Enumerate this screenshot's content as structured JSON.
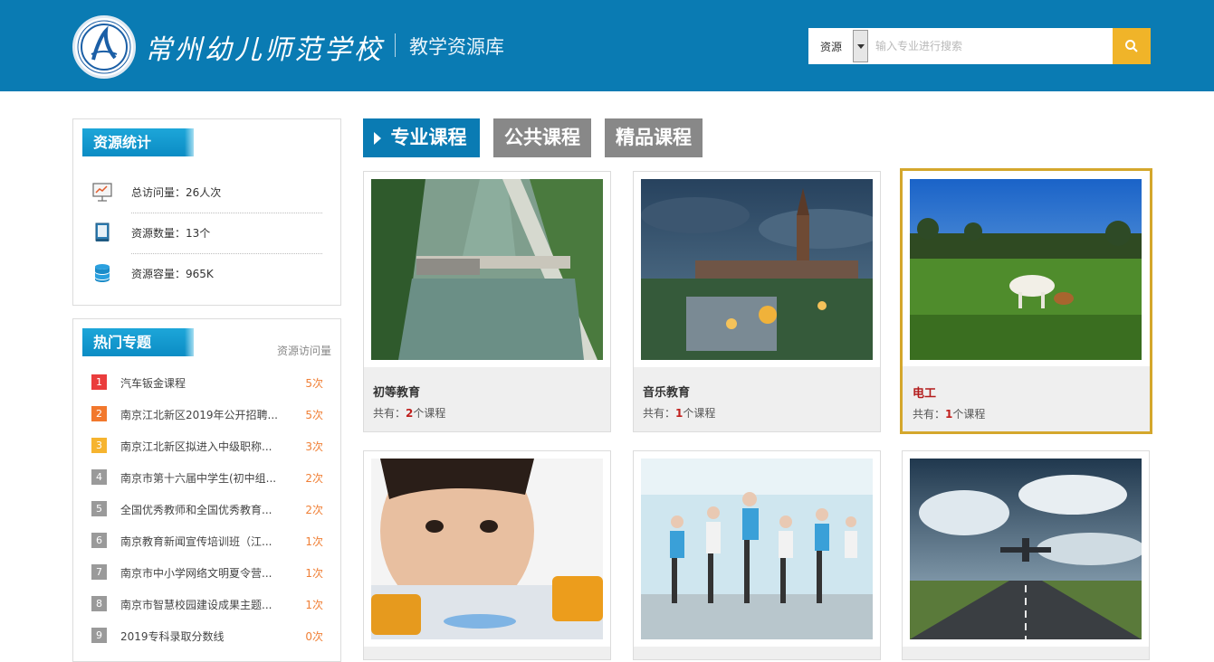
{
  "header": {
    "school_name": "常州幼儿师范学校",
    "subtitle": "教学资源库",
    "search": {
      "select_value": "资源",
      "placeholder": "输入专业进行搜索"
    },
    "icons": {
      "logo": "school-logo-icon",
      "search": "search-icon"
    }
  },
  "stats": {
    "title": "资源统计",
    "items": [
      {
        "icon": "chart-board-icon",
        "label": "总访问量：26人次"
      },
      {
        "icon": "book-icon",
        "label": "资源数量：13个"
      },
      {
        "icon": "database-icon",
        "label": "资源容量：965K"
      }
    ]
  },
  "hot": {
    "title": "热门专题",
    "column_label": "资源访问量",
    "items": [
      {
        "rank": "1",
        "title": "汽车钣金课程",
        "count": "5次"
      },
      {
        "rank": "2",
        "title": "南京江北新区2019年公开招聘...",
        "count": "5次"
      },
      {
        "rank": "3",
        "title": "南京江北新区拟进入中级职称...",
        "count": "3次"
      },
      {
        "rank": "4",
        "title": "南京市第十六届中学生(初中组...",
        "count": "2次"
      },
      {
        "rank": "5",
        "title": "全国优秀教师和全国优秀教育...",
        "count": "2次"
      },
      {
        "rank": "6",
        "title": "南京教育新闻宣传培训班（江...",
        "count": "1次"
      },
      {
        "rank": "7",
        "title": "南京市中小学网络文明夏令营...",
        "count": "1次"
      },
      {
        "rank": "8",
        "title": "南京市智慧校园建设成果主题...",
        "count": "1次"
      },
      {
        "rank": "9",
        "title": "2019专科录取分数线",
        "count": "0次"
      }
    ]
  },
  "tabs": [
    {
      "label": "专业课程",
      "active": true
    },
    {
      "label": "公共课程",
      "active": false
    },
    {
      "label": "精品课程",
      "active": false
    }
  ],
  "cards": [
    {
      "name": "初等教育",
      "count_prefix": "共有：",
      "count": "2",
      "count_suffix": "个课程",
      "image": "dam-river-aerial"
    },
    {
      "name": "音乐教育",
      "count_prefix": "共有：",
      "count": "1",
      "count_suffix": "个课程",
      "image": "city-church-dusk"
    },
    {
      "name": "电工",
      "count_prefix": "共有：",
      "count": "1",
      "count_suffix": "个课程",
      "image": "cow-meadow"
    },
    {
      "image": "child-pills"
    },
    {
      "image": "fitness-class"
    },
    {
      "image": "airplane-runway"
    }
  ],
  "colors": {
    "header_bg": "#0a7bb3",
    "search_button": "#f0b429",
    "tab_inactive": "#888888",
    "selected_border": "#d4a72c",
    "count_red": "#c0201d",
    "hot_count": "#f08037"
  }
}
